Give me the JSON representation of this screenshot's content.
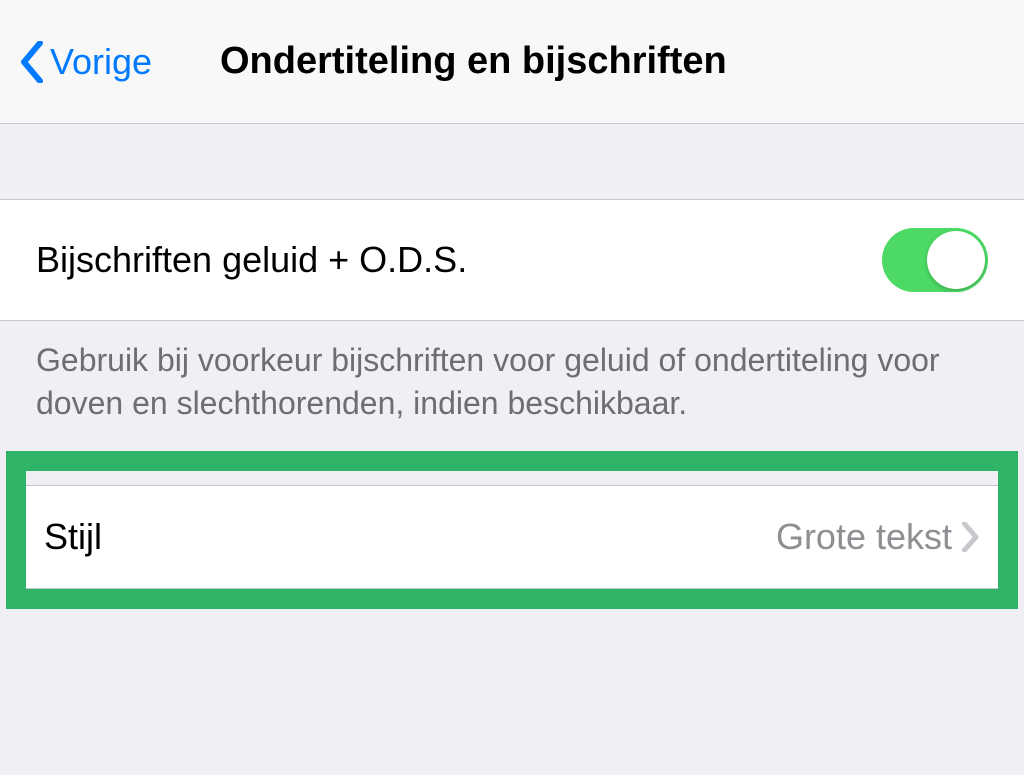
{
  "nav": {
    "back_label": "Vorige",
    "title": "Ondertiteling en bijschriften"
  },
  "captions": {
    "toggle_label": "Bijschriften geluid + O.D.S.",
    "toggle_on": true,
    "footer": "Gebruik bij voorkeur bijschriften voor geluid of ondertiteling voor doven en slechthorenden, indien beschikbaar."
  },
  "style_row": {
    "label": "Stijl",
    "value": "Grote tekst"
  },
  "colors": {
    "accent": "#007aff",
    "toggle_on": "#4cd964",
    "highlight": "#2fb366"
  }
}
